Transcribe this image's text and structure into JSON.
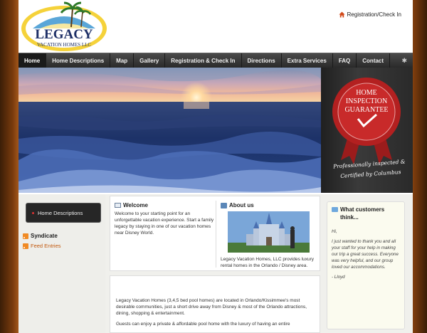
{
  "header": {
    "logo_text": "LEGACY",
    "logo_subtext": "VACATION HOMES LLC",
    "registration_link": "Registration/Check In"
  },
  "nav": {
    "items": [
      {
        "label": "Home",
        "active": true
      },
      {
        "label": "Home Descriptions"
      },
      {
        "label": "Map"
      },
      {
        "label": "Gallery"
      },
      {
        "label": "Registration & Check In"
      },
      {
        "label": "Directions"
      },
      {
        "label": "Extra Services"
      },
      {
        "label": "FAQ"
      },
      {
        "label": "Contact"
      }
    ],
    "gear_icon": "gear-icon"
  },
  "banner": {
    "seal_line1": "HOME",
    "seal_line2": "INSPECTION",
    "seal_line3": "GUARANTEE",
    "script_line1": "Professionally inspected &",
    "script_line2": "Certified by Columbus"
  },
  "sidebar": {
    "menu_item": "Home Descriptions",
    "syndicate_title": "Syndicate",
    "feed_link": "Feed Entries"
  },
  "welcome": {
    "title": "Welcome",
    "text": "Welcome to your starting point for an unforgettable vacation experience. Start a family legacy by staying in one of our vacation homes near Disney World."
  },
  "about": {
    "title": "About us",
    "text": "Legacy Vacation Homes, LLC provides luxury rental homes in the Orlando / Disney area."
  },
  "main": {
    "para1": "Legacy Vacation Homes (3,4,5 bed pool homes) are located in Orlando/Kissimmee's most desirable communities, just a short drive away from Disney & most of the Orlando attractions, dining, shopping & entertainment.",
    "para2": "Guests can enjoy a private & affordable pool home with the luxury of having an entire"
  },
  "testimonial": {
    "title": "What customers think...",
    "greeting": "Hi,",
    "body": "I just wanted to thank you and all your staff for your help in making our trip a great success. Everyone was very helpful, and our group loved our accommodations.",
    "signature": "- Lloyd"
  }
}
